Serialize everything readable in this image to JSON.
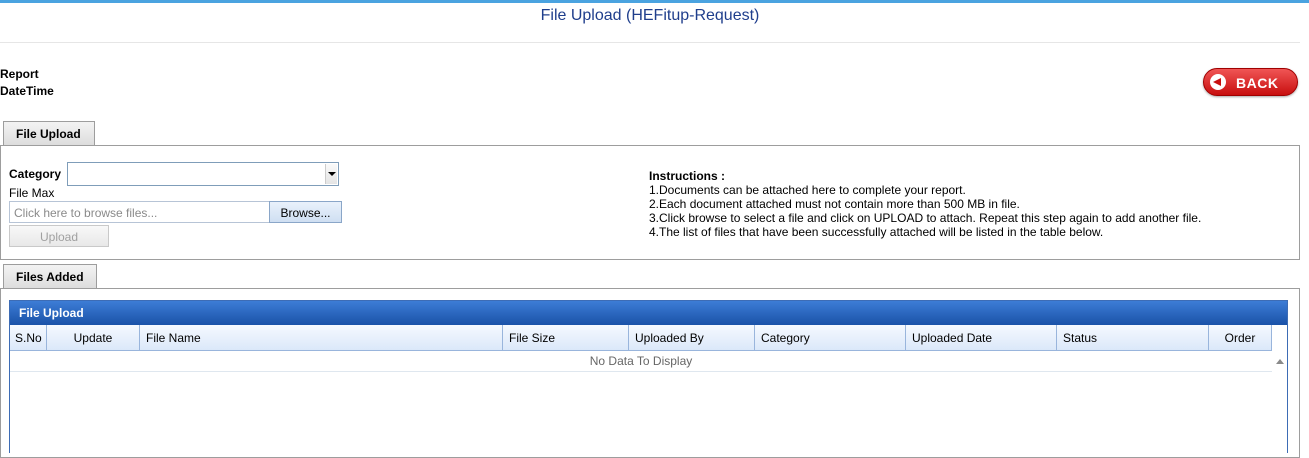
{
  "page": {
    "title": "File Upload (HEFitup-Request)"
  },
  "report": {
    "line1": "Report",
    "line2": "DateTime"
  },
  "back_button": {
    "label": "BACK"
  },
  "tabs": {
    "file_upload": "File Upload",
    "files_added": "Files Added"
  },
  "form": {
    "category_label": "Category",
    "category_value": "",
    "file_max_label": "File Max",
    "file_placeholder": "Click here to browse files...",
    "browse_label": "Browse...",
    "upload_label": "Upload"
  },
  "instructions": {
    "heading": "Instructions :",
    "lines": [
      "1.Documents can be attached here to complete your report.",
      "2.Each document attached must not contain more than 500 MB in file.",
      "3.Click browse to select a file and click on UPLOAD to attach. Repeat this step again to add another file.",
      "4.The list of files that have been successfully attached will be listed in the table below."
    ]
  },
  "grid": {
    "title": "File Upload",
    "columns": [
      "S.No",
      "Update",
      "File Name",
      "File Size",
      "Uploaded By",
      "Category",
      "Uploaded Date",
      "Status",
      "Order"
    ],
    "empty_text": "No Data To Display"
  },
  "colors": {
    "title_text": "#1f3e8c",
    "grid_header": "#1a52a8",
    "back_button": "#c80f0f"
  }
}
